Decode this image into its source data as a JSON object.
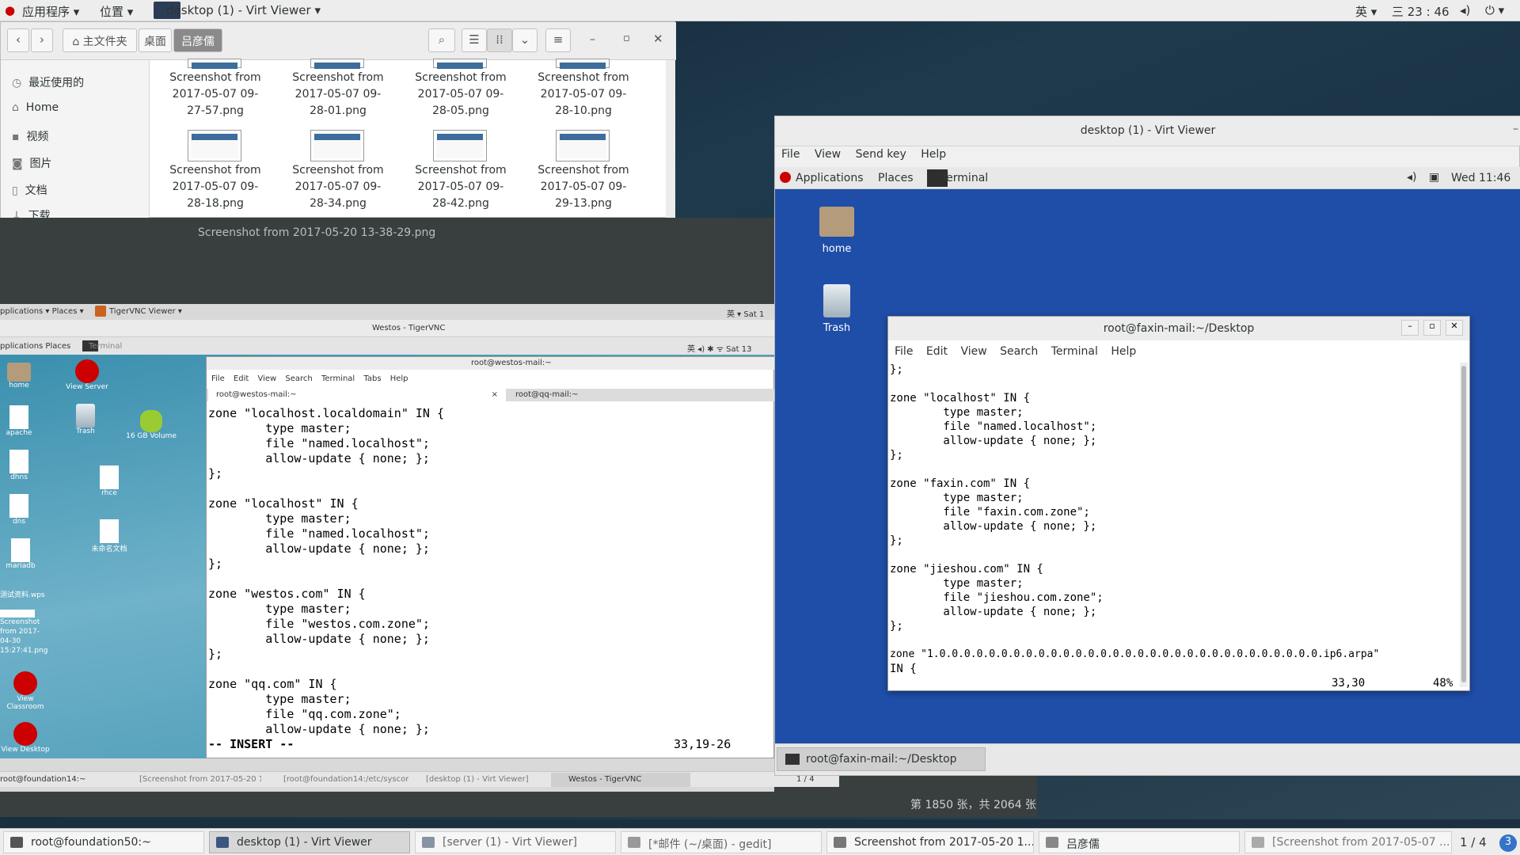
{
  "topbar": {
    "apps": "应用程序",
    "places": "位置",
    "window": "desktop (1) - Virt Viewer",
    "ime": "英",
    "clock": "三 23 : 46"
  },
  "file_manager": {
    "breadcrumbs": [
      "主文件夹",
      "桌面",
      "吕彦儒"
    ],
    "sidebar": [
      "最近使用的",
      "Home",
      "视频",
      "图片",
      "文档",
      "下载"
    ],
    "files": [
      [
        "Screenshot from",
        "2017-05-07 09-",
        "27-57.png"
      ],
      [
        "Screenshot from",
        "2017-05-07 09-",
        "28-01.png"
      ],
      [
        "Screenshot from",
        "2017-05-07 09-",
        "28-05.png"
      ],
      [
        "Screenshot from",
        "2017-05-07 09-",
        "28-10.png"
      ],
      [
        "Screenshot from",
        "2017-05-07 09-",
        "28-18.png"
      ],
      [
        "Screenshot from",
        "2017-05-07 09-",
        "28-34.png"
      ],
      [
        "Screenshot from",
        "2017-05-07 09-",
        "28-42.png"
      ],
      [
        "Screenshot from",
        "2017-05-07 09-",
        "29-13.png"
      ]
    ]
  },
  "image_viewer": {
    "title": "Screenshot from 2017-05-20 13-38-29.png",
    "counter": "第 1850 张，共 2064 张"
  },
  "vnc": {
    "topbar_left": "pplications ▾   Places ▾",
    "topbar_app": "TigerVNC Viewer ▾",
    "topbar_right": "英 ▾   Sat 1",
    "title": "Westos - TigerVNC",
    "inner_apps": "pplications   Places",
    "inner_terminal": "Terminal",
    "inner_right": "英  ◂)  ✱  ᯤ  Sat 13",
    "desktop_icons": [
      "home",
      "View Server",
      "apache",
      "Trash",
      "16 GB Volume",
      "dhns",
      "rhce",
      "dns",
      "未命名文档",
      "mariadb",
      "测试资料.wps",
      "Screenshot from 2017-04-30 15:27:41.png",
      "View Classroom",
      "View Desktop"
    ],
    "terminal_title": "root@westos-mail:~",
    "terminal_menu": [
      "File",
      "Edit",
      "View",
      "Search",
      "Terminal",
      "Tabs",
      "Help"
    ],
    "tabs": [
      "root@westos-mail:~",
      "root@qq-mail:~"
    ],
    "lines": [
      "zone \"localhost.localdomain\" IN {",
      "        type master;",
      "        file \"named.localhost\";",
      "        allow-update { none; };",
      "};",
      "",
      "zone \"localhost\" IN {",
      "        type master;",
      "        file \"named.localhost\";",
      "        allow-update { none; };",
      "};",
      "",
      "zone \"westos.com\" IN {",
      "        type master;",
      "        file \"westos.com.zone\";",
      "        allow-update { none; };",
      "};",
      "",
      "zone \"qq.com\" IN {",
      "        type master;",
      "        file \"qq.com.zone\";",
      "        allow-update { none; };"
    ],
    "status_mode": "-- INSERT --",
    "status_pos": "33,19-26",
    "taskbar": [
      "root@foundation14:~",
      "[Screenshot from 2017-05-20 1...",
      "[root@foundation14:/etc/syscon...",
      "[desktop (1) - Virt Viewer]",
      "Westos - TigerVNC"
    ],
    "pager": "1 / 4"
  },
  "virt_viewer": {
    "title": "desktop (1) - Virt Viewer",
    "menu": [
      "File",
      "View",
      "Send key",
      "Help"
    ],
    "guest_apps": "Applications",
    "guest_places": "Places",
    "guest_terminal": "Terminal",
    "guest_clock": "Wed 11:46",
    "icons": [
      "home",
      "Trash"
    ],
    "terminal_title": "root@faxin-mail:~/Desktop",
    "terminal_menu": [
      "File",
      "Edit",
      "View",
      "Search",
      "Terminal",
      "Help"
    ],
    "lines": [
      "};",
      "",
      "zone \"localhost\" IN {",
      "        type master;",
      "        file \"named.localhost\";",
      "        allow-update { none; };",
      "};",
      "",
      "zone \"faxin.com\" IN {",
      "        type master;",
      "        file \"faxin.com.zone\";",
      "        allow-update { none; };",
      "};",
      "",
      "zone \"jieshou.com\" IN {",
      "        type master;",
      "        file \"jieshou.com.zone\";",
      "        allow-update { none; };",
      "};",
      "",
      "zone \"1.0.0.0.0.0.0.0.0.0.0.0.0.0.0.0.0.0.0.0.0.0.0.0.0.0.0.0.0.0.0.0.ip6.arpa\"",
      "IN {"
    ],
    "status_pos": "33,30",
    "status_pct": "48%",
    "guest_taskbar": "root@faxin-mail:~/Desktop"
  },
  "taskbar": {
    "items": [
      "root@foundation50:~",
      "desktop (1) - Virt Viewer",
      "[server (1) - Virt Viewer]",
      "[*邮件 (~/桌面) - gedit]",
      "Screenshot from 2017-05-20 1...",
      "吕彦儒",
      "[Screenshot from 2017-05-07 ..."
    ],
    "pager": "1 / 4"
  }
}
